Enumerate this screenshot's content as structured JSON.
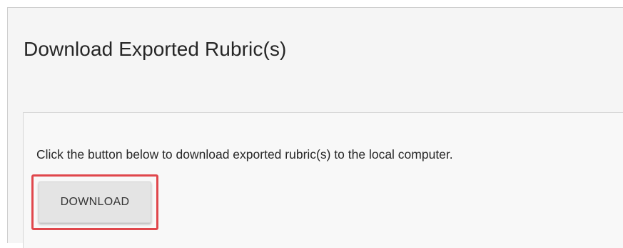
{
  "dialog": {
    "title": "Download Exported Rubric(s)",
    "instruction": "Click the button below to download exported rubric(s) to the local computer.",
    "download_label": "DOWNLOAD"
  },
  "colors": {
    "highlight": "#e0474c",
    "button_bg": "#e4e4e4",
    "panel_bg": "#f5f5f5",
    "text": "#262626"
  }
}
